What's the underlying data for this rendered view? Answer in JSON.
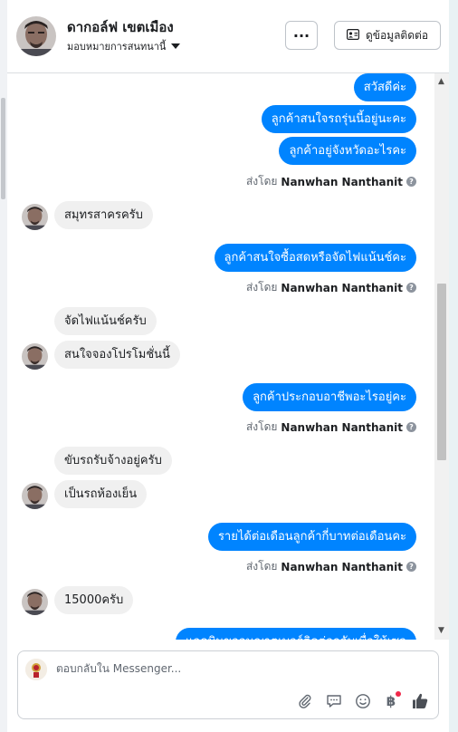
{
  "header": {
    "contact_name": "ดากอล์ฟ เขตเมือง",
    "assign_label": "มอบหมายการสนทนานี้",
    "more_label": "···",
    "contact_info_label": "ดูข้อมูลติดต่อ"
  },
  "messages": {
    "m1": "สวัสดีค่ะ",
    "m2": "ลูกค้าสนใจรถรุ่นนี้อยู่นะคะ",
    "m3": "ลูกค้าอยู่จังหวัดอะไรคะ",
    "sent1_prefix": "ส่งโดย",
    "sent1_name": "Nanwhan Nanthanit",
    "m4": "สมุทรสาครครับ",
    "m5": "ลูกค้าสนใจซื้อสดหรือจัดไฟแน้นช์คะ",
    "sent2_prefix": "ส่งโดย",
    "sent2_name": "Nanwhan Nanthanit",
    "m6": "จัดไฟแน้นช์ครับ",
    "m7": "สนใจจองโปรโมชั่นนี้",
    "m8": "ลูกค้าประกอบอาชีพอะไรอยู่คะ",
    "sent3_prefix": "ส่งโดย",
    "sent3_name": "Nanwhan Nanthanit",
    "m9": "ขับรถรับจ้างอยู่ครับ",
    "m10": "เป็นรถห้องเย็น",
    "m11": "รายได้ต่อเดือนลูกค้ากี่บาทต่อเดือนคะ",
    "sent4_prefix": "ส่งโดย",
    "sent4_name": "Nanwhan Nanthanit",
    "m12": "15000ครับ",
    "m13": "แอดมินขออนุญาตเบอร์ติดต่อกลับเพื่อให้เซล"
  },
  "reply": {
    "placeholder": "ตอบกลับใน Messenger..."
  },
  "icons": {
    "attach": "paperclip-icon",
    "comment": "comment-icon",
    "emoji": "smile-icon",
    "payment": "baht-icon",
    "like": "thumbs-up-icon"
  },
  "colors": {
    "outgoing_bubble": "#0084ff",
    "incoming_bubble": "#f0f0f0",
    "notification_dot": "#f02849"
  }
}
